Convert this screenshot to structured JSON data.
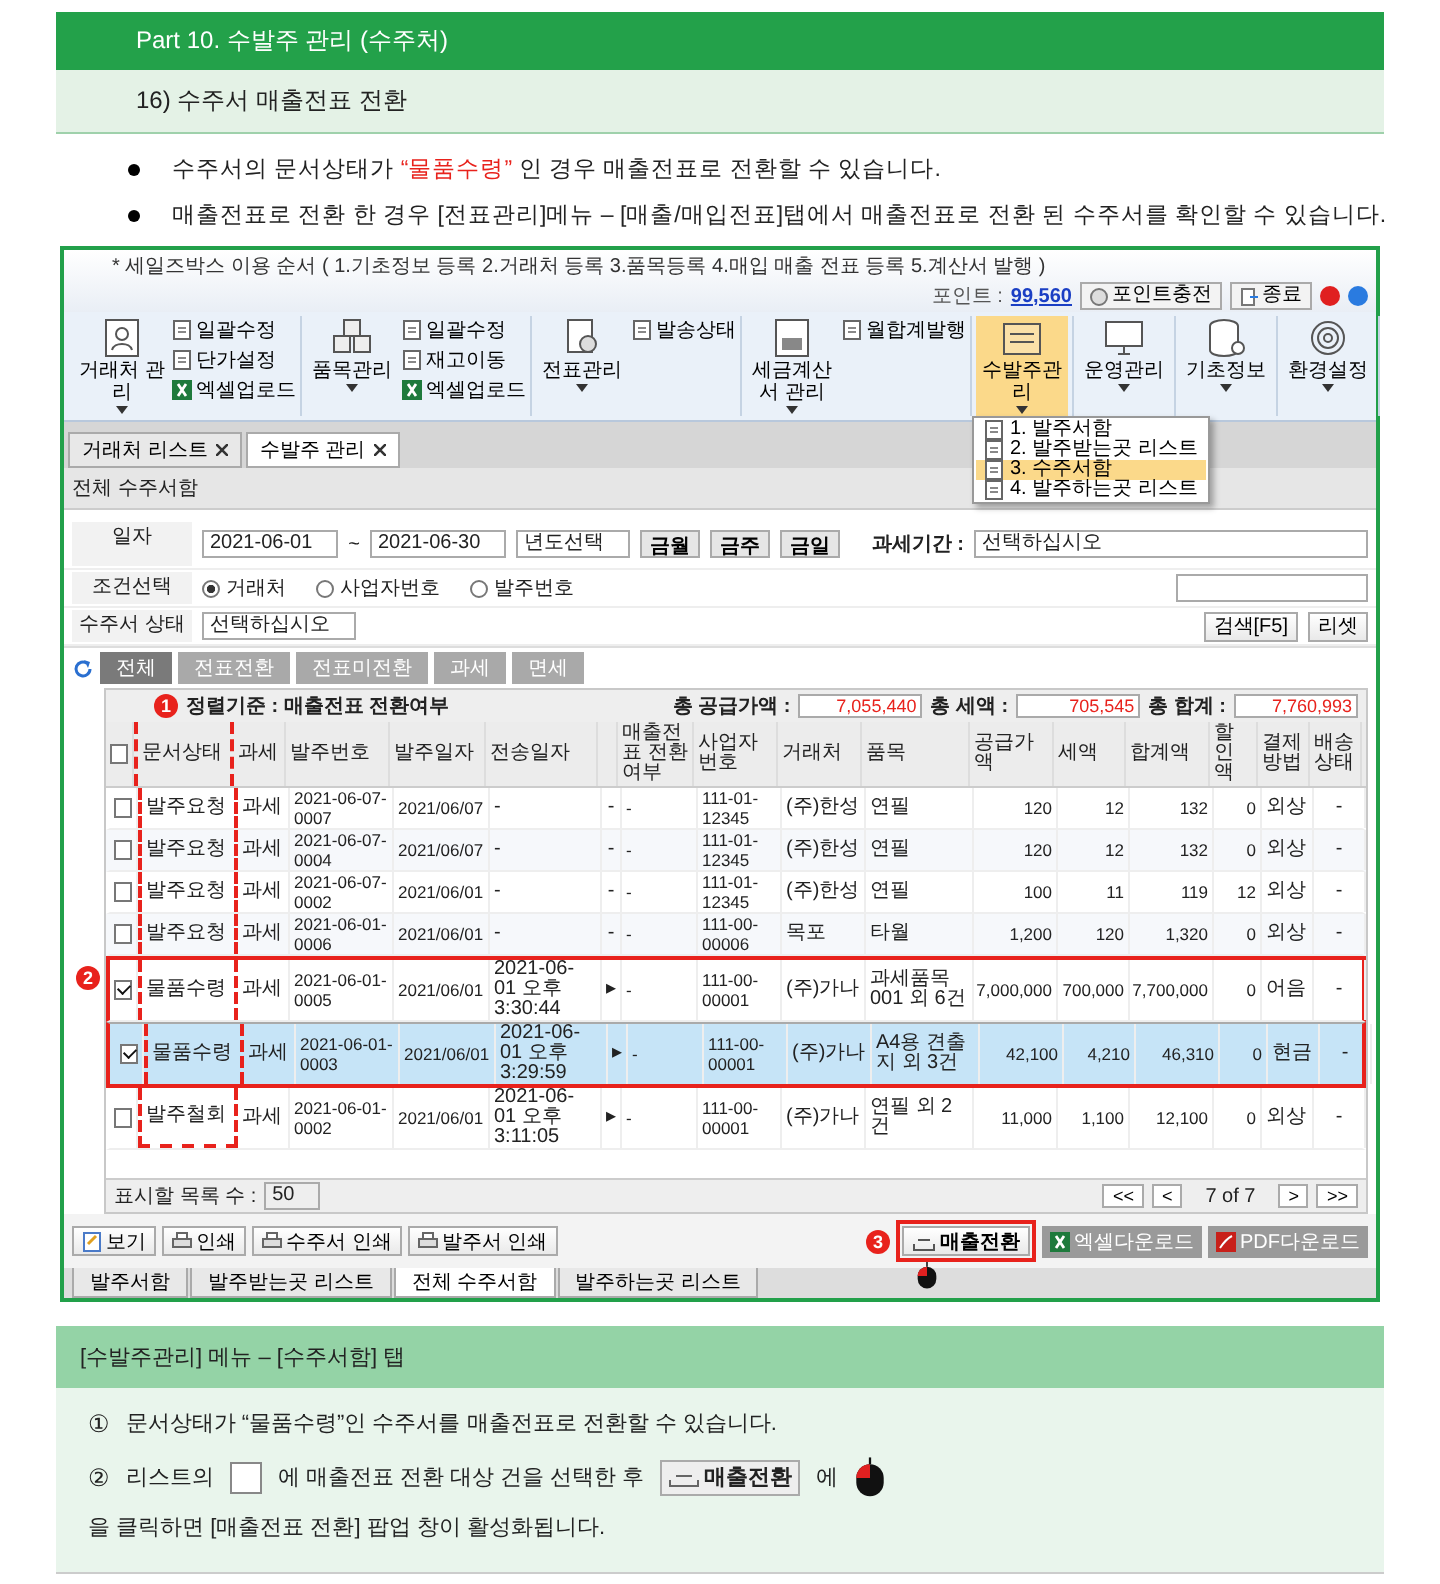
{
  "part_title": "Part 10. 수발주 관리 (수주처)",
  "section_title": "16) 수주서 매출전표 전환",
  "bullets": [
    {
      "segments": [
        {
          "text": "수주서의 문서상태가 ",
          "emphasis": false
        },
        {
          "text": "“물품수령”",
          "emphasis": true
        },
        {
          "text": " 인 경우 매출전표로 전환할 수 있습니다.",
          "emphasis": false
        }
      ]
    },
    {
      "segments": [
        {
          "text": "매출전표로 전환 한 경우 [전표관리]메뉴 – [매출/매입전표]탭에서 매출전표로 전환 된 수주서를 확인할 수 있습니다.",
          "emphasis": false
        }
      ]
    }
  ],
  "app": {
    "guide": "* 세일즈박스 이용 순서 ( 1.기초정보 등록 2.거래처 등록 3.품목등록 4.매입 매출 전표 등록 5.계산서 발행 )",
    "points_label": "포인트 :",
    "points": "99,560",
    "top_buttons": [
      {
        "label": "포인트충전",
        "kind": "charge"
      },
      {
        "label": "종료",
        "kind": "exit"
      }
    ],
    "ribbon": [
      {
        "label": "거래처 관리",
        "kind": "person",
        "selected": false,
        "sub": [
          {
            "label": "일괄수정",
            "kind": "doc"
          },
          {
            "label": "단가설정",
            "kind": "doc"
          },
          {
            "label": "엑셀업로드",
            "kind": "excel"
          }
        ]
      },
      {
        "label": "품목관리",
        "kind": "boxes",
        "selected": false,
        "sub": [
          {
            "label": "일괄수정",
            "kind": "doc"
          },
          {
            "label": "재고이동",
            "kind": "doc"
          },
          {
            "label": "엑셀업로드",
            "kind": "excel"
          }
        ]
      },
      {
        "label": "전표관리",
        "kind": "doc",
        "selected": false,
        "sub": [
          {
            "label": "발송상태",
            "kind": "doc"
          }
        ]
      },
      {
        "label": "세금계산서 관리",
        "kind": "invoice",
        "selected": false,
        "sub": [
          {
            "label": "월합계발행",
            "kind": "doc"
          }
        ]
      },
      {
        "label": "수발주관리",
        "kind": "orders",
        "selected": true
      },
      {
        "label": "운영관리",
        "kind": "monitor",
        "selected": false
      },
      {
        "label": "기초정보",
        "kind": "database",
        "selected": false
      },
      {
        "label": "환경설정",
        "kind": "fingerprint",
        "selected": false
      }
    ],
    "menu": [
      {
        "label": "1. 발주서함",
        "selected": false
      },
      {
        "label": "2. 발주받는곳 리스트",
        "selected": false
      },
      {
        "label": "3. 수주서함",
        "selected": true
      },
      {
        "label": "4. 발주하는곳 리스트",
        "selected": false
      }
    ],
    "window_tabs": [
      {
        "label": "거래처 리스트",
        "selected": false
      },
      {
        "label": "수발주 관리",
        "selected": true
      }
    ],
    "panel_title": "전체 수주서함",
    "filters": {
      "date_label": "일자",
      "date_from": "2021-06-01",
      "date_sep": "~",
      "date_to": "2021-06-30",
      "year_select": "년도선택",
      "quick": [
        "금월",
        "금주",
        "금일"
      ],
      "period_label": "과세기간 :",
      "period_value": "선택하십시오",
      "condition_label": "조건선택",
      "conditions": [
        {
          "label": "거래처",
          "selected": true
        },
        {
          "label": "사업자번호",
          "selected": false
        },
        {
          "label": "발주번호",
          "selected": false
        }
      ],
      "status_label": "수주서 상태",
      "status_value": "선택하십시오",
      "search": "검색[F5]",
      "reset": "리셋"
    },
    "filter_tabs": [
      {
        "label": "전체",
        "selected": true
      },
      {
        "label": "전표전환",
        "selected": false
      },
      {
        "label": "전표미전환",
        "selected": false
      },
      {
        "label": "과세",
        "selected": false
      },
      {
        "label": "면세",
        "selected": false
      }
    ],
    "sort_label": "정렬기준 : 매출전표 전환여부",
    "totals": [
      {
        "label": "총 공급가액 :",
        "value": "7,055,440"
      },
      {
        "label": "총 세액 :",
        "value": "705,545"
      },
      {
        "label": "총 합계 :",
        "value": "7,760,993"
      }
    ],
    "table": {
      "column_badge": "1",
      "rows_badge": "2",
      "header_checked": false,
      "columns": [
        {
          "label": "문서상태",
          "kind": "text"
        },
        {
          "label": "과세",
          "kind": "text"
        },
        {
          "label": "발주번호",
          "kind": "text"
        },
        {
          "label": "발주일자",
          "kind": "text"
        },
        {
          "label": "전송일자",
          "kind": "text"
        },
        {
          "kind": "blank"
        },
        {
          "label": "매출전표 전환여부",
          "kind": "text"
        },
        {
          "label": "사업자번호",
          "kind": "text"
        },
        {
          "label": "거래처",
          "kind": "text"
        },
        {
          "label": "품목",
          "kind": "text"
        },
        {
          "label": "공급가액",
          "kind": "number"
        },
        {
          "label": "세액",
          "kind": "number"
        },
        {
          "label": "합계액",
          "kind": "number"
        },
        {
          "label": "할인액",
          "kind": "number"
        },
        {
          "label": "결제방법",
          "kind": "text"
        },
        {
          "label": "배송상태",
          "kind": "center"
        }
      ],
      "rows": [
        {
          "checked": false,
          "selected": false,
          "marked": false,
          "cells": [
            "발주요청",
            "과세",
            "2021-06-07-0007",
            "2021/06/07",
            "-",
            "-",
            "-",
            "111-01-12345",
            "(주)한성",
            "연필",
            "120",
            "12",
            "132",
            "0",
            "외상",
            "-"
          ]
        },
        {
          "checked": false,
          "selected": false,
          "marked": false,
          "cells": [
            "발주요청",
            "과세",
            "2021-06-07-0004",
            "2021/06/07",
            "-",
            "-",
            "-",
            "111-01-12345",
            "(주)한성",
            "연필",
            "120",
            "12",
            "132",
            "0",
            "외상",
            "-"
          ]
        },
        {
          "checked": false,
          "selected": false,
          "marked": false,
          "cells": [
            "발주요청",
            "과세",
            "2021-06-07-0002",
            "2021/06/01",
            "-",
            "-",
            "-",
            "111-01-12345",
            "(주)한성",
            "연필",
            "100",
            "11",
            "119",
            "12",
            "외상",
            "-"
          ]
        },
        {
          "checked": false,
          "selected": false,
          "marked": false,
          "cells": [
            "발주요청",
            "과세",
            "2021-06-01-0006",
            "2021/06/01",
            "-",
            "-",
            "-",
            "111-00-00006",
            "목포",
            "타월",
            "1,200",
            "120",
            "1,320",
            "0",
            "외상",
            "-"
          ]
        },
        {
          "checked": true,
          "selected": false,
          "marked": true,
          "cells": [
            "물품수령",
            "과세",
            "2021-06-01-0005",
            "2021/06/01",
            "2021-06-01 오후 3:30:44",
            "▸",
            "-",
            "111-00-00001",
            "(주)가나",
            "과세품목001 외 6건",
            "7,000,000",
            "700,000",
            "7,700,000",
            "0",
            "어음",
            "-"
          ]
        },
        {
          "checked": true,
          "selected": true,
          "marked": true,
          "cells": [
            "물품수령",
            "과세",
            "2021-06-01-0003",
            "2021/06/01",
            "2021-06-01 오후 3:29:59",
            "▸",
            "-",
            "111-00-00001",
            "(주)가나",
            "A4용 견출지 외 3건",
            "42,100",
            "4,210",
            "46,310",
            "0",
            "현금",
            "-"
          ]
        },
        {
          "checked": false,
          "selected": false,
          "marked": false,
          "cells": [
            "발주철회",
            "과세",
            "2021-06-01-0002",
            "2021/06/01",
            "2021-06-01 오후 3:11:05",
            "▸",
            "-",
            "111-00-00001",
            "(주)가나",
            "연필 외 2건",
            "11,000",
            "1,100",
            "12,100",
            "0",
            "외상",
            "-"
          ]
        }
      ]
    },
    "page_size_label": "표시할 목록 수 :",
    "page_size": "50",
    "pager": [
      {
        "label": "<<",
        "kind": "button"
      },
      {
        "label": "<",
        "kind": "button"
      },
      {
        "label": "7 of 7",
        "kind": "text"
      },
      {
        "label": ">",
        "kind": "button"
      },
      {
        "label": ">>",
        "kind": "button"
      }
    ],
    "bottom_buttons": [
      {
        "label": "보기",
        "kind": "view"
      },
      {
        "label": "인쇄",
        "kind": "print"
      },
      {
        "label": "수주서 인쇄",
        "kind": "print"
      },
      {
        "label": "발주서 인쇄",
        "kind": "print"
      }
    ],
    "action_buttons": [
      {
        "label": "매출전환",
        "kind": "convert",
        "badge": "3"
      },
      {
        "label": "엑셀다운로드",
        "kind": "excel"
      },
      {
        "label": "PDF다운로드",
        "kind": "pdf"
      }
    ],
    "bottom_tabs": [
      {
        "label": "발주서함",
        "selected": false
      },
      {
        "label": "발주받는곳 리스트",
        "selected": false
      },
      {
        "label": "전체 수주서함",
        "selected": true
      },
      {
        "label": "발주하는곳 리스트",
        "selected": false
      }
    ]
  },
  "guide_box": {
    "title": "[수발주관리] 메뉴 – [수주서함] 탭",
    "items": [
      {
        "number": "①",
        "segments": [
          {
            "kind": "text",
            "text": "문서상태가 “물품수령”인 수주서를 매출전표로 전환할 수 있습니다."
          }
        ]
      },
      {
        "number": "②",
        "segments": [
          {
            "kind": "text",
            "text": "리스트의"
          },
          {
            "kind": "checkbox"
          },
          {
            "kind": "text",
            "text": "에  매출전표 전환 대상 건을  선택한 후"
          },
          {
            "kind": "button",
            "text": "매출전환"
          },
          {
            "kind": "text",
            "text": "에"
          },
          {
            "kind": "mouse"
          },
          {
            "kind": "text",
            "text": "을 클릭하면  [매출전표 전환] 팝업 창이 활성화됩니다."
          }
        ]
      }
    ]
  }
}
